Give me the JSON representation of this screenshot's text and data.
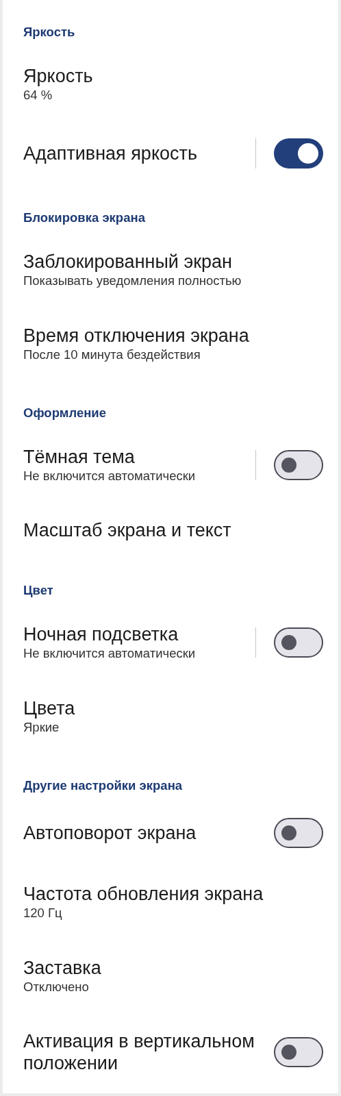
{
  "sections": [
    {
      "header": "Яркость",
      "items": [
        {
          "kind": "plain",
          "title": "Яркость",
          "subtitle": "64 %"
        },
        {
          "kind": "toggle",
          "title": "Адаптивная яркость",
          "on": true,
          "divider": true
        }
      ]
    },
    {
      "header": "Блокировка экрана",
      "items": [
        {
          "kind": "plain",
          "title": "Заблокированный экран",
          "subtitle": "Показывать уведомления полностью"
        },
        {
          "kind": "plain",
          "title": "Время отключения экрана",
          "subtitle": "После 10 минута бездействия"
        }
      ]
    },
    {
      "header": "Оформление",
      "items": [
        {
          "kind": "toggle",
          "title": "Тёмная тема",
          "subtitle": "Не включится автоматически",
          "on": false,
          "divider": true
        },
        {
          "kind": "plain",
          "title": "Масштаб экрана и текст"
        }
      ]
    },
    {
      "header": "Цвет",
      "items": [
        {
          "kind": "toggle",
          "title": "Ночная подсветка",
          "subtitle": "Не включится автоматически",
          "on": false,
          "divider": true
        },
        {
          "kind": "plain",
          "title": "Цвета",
          "subtitle": "Яркие"
        }
      ]
    },
    {
      "header": "Другие настройки экрана",
      "items": [
        {
          "kind": "toggle",
          "title": "Автоповорот экрана",
          "on": false,
          "divider": false
        },
        {
          "kind": "plain",
          "title": "Частота обновления экрана",
          "subtitle": "120 Гц"
        },
        {
          "kind": "plain",
          "title": "Заставка",
          "subtitle": "Отключено"
        },
        {
          "kind": "toggle",
          "title": "Активация в вертикальном положении",
          "on": false,
          "divider": false
        }
      ]
    }
  ]
}
